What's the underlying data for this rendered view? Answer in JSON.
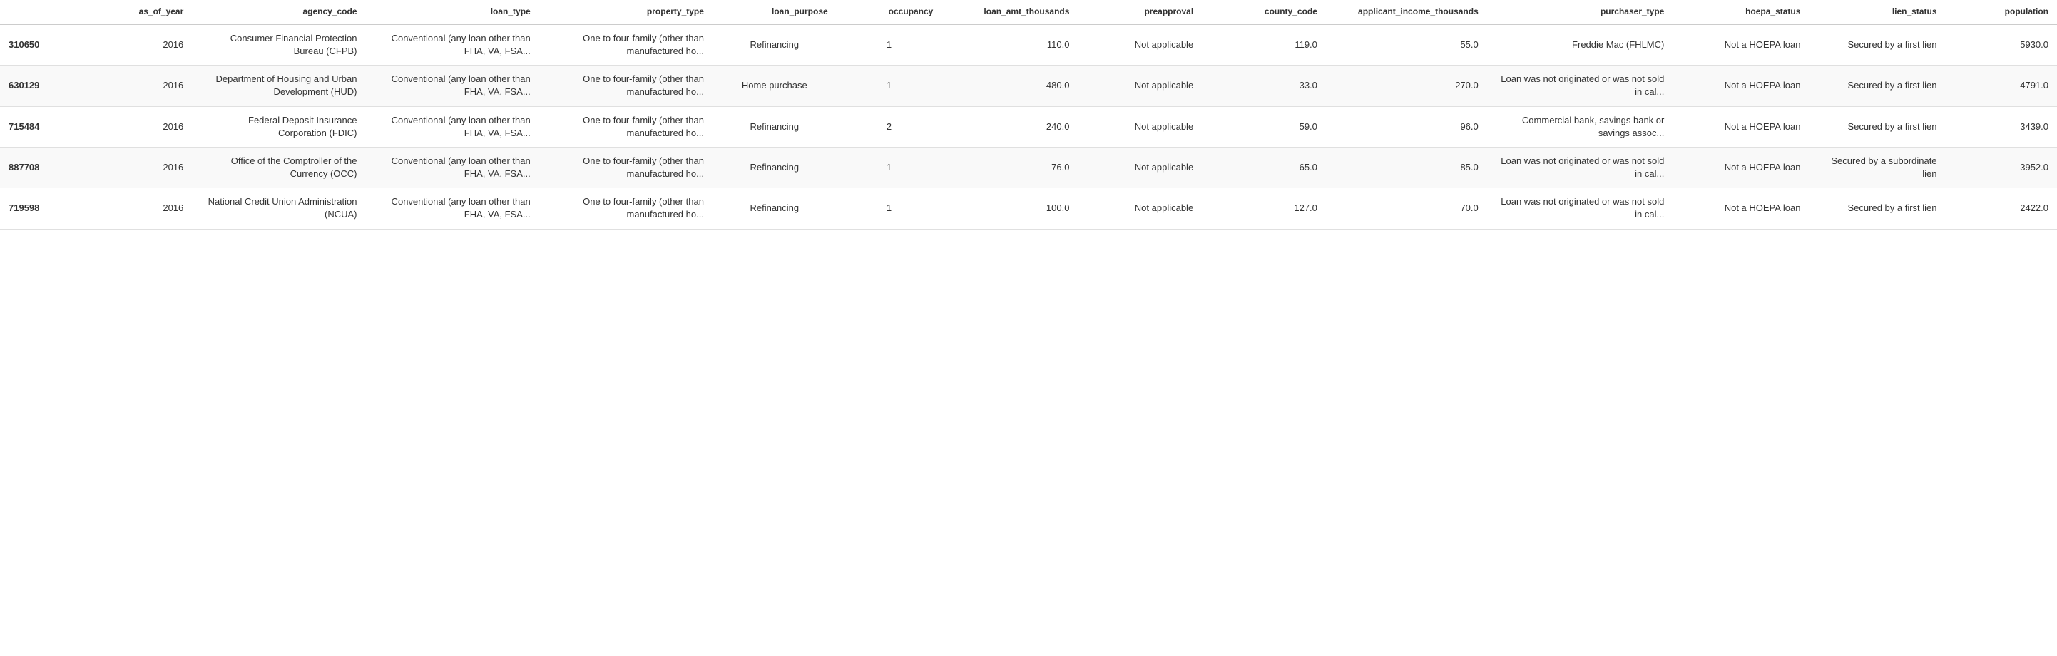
{
  "table": {
    "columns": [
      {
        "id": "id_col",
        "label": "",
        "key": "id"
      },
      {
        "id": "as_of_year",
        "label": "as_of_year",
        "key": "as_of_year"
      },
      {
        "id": "agency_code",
        "label": "agency_code",
        "key": "agency_code"
      },
      {
        "id": "loan_type",
        "label": "loan_type",
        "key": "loan_type"
      },
      {
        "id": "property_type",
        "label": "property_type",
        "key": "property_type"
      },
      {
        "id": "loan_purpose",
        "label": "loan_purpose",
        "key": "loan_purpose"
      },
      {
        "id": "occupancy",
        "label": "occupancy",
        "key": "occupancy"
      },
      {
        "id": "loan_amt_thousands",
        "label": "loan_amt_thousands",
        "key": "loan_amt_thousands"
      },
      {
        "id": "preapproval",
        "label": "preapproval",
        "key": "preapproval"
      },
      {
        "id": "county_code",
        "label": "county_code",
        "key": "county_code"
      },
      {
        "id": "applicant_income_thousands",
        "label": "applicant_income_thousands",
        "key": "applicant_income_thousands"
      },
      {
        "id": "purchaser_type",
        "label": "purchaser_type",
        "key": "purchaser_type"
      },
      {
        "id": "hoepa_status",
        "label": "hoepa_status",
        "key": "hoepa_status"
      },
      {
        "id": "lien_status",
        "label": "lien_status",
        "key": "lien_status"
      },
      {
        "id": "population",
        "label": "population",
        "key": "population"
      }
    ],
    "rows": [
      {
        "id": "310650",
        "as_of_year": "2016",
        "agency_code": "Consumer Financial Protection Bureau (CFPB)",
        "loan_type": "Conventional (any loan other than FHA, VA, FSA...",
        "property_type": "One to four-family (other than manufactured ho...",
        "loan_purpose": "Refinancing",
        "occupancy": "1",
        "loan_amt_thousands": "110.0",
        "preapproval": "Not applicable",
        "county_code": "119.0",
        "applicant_income_thousands": "55.0",
        "purchaser_type": "Freddie Mac (FHLMC)",
        "hoepa_status": "Not a HOEPA loan",
        "lien_status": "Secured by a first lien",
        "population": "5930.0"
      },
      {
        "id": "630129",
        "as_of_year": "2016",
        "agency_code": "Department of Housing and Urban Development (HUD)",
        "loan_type": "Conventional (any loan other than FHA, VA, FSA...",
        "property_type": "One to four-family (other than manufactured ho...",
        "loan_purpose": "Home purchase",
        "occupancy": "1",
        "loan_amt_thousands": "480.0",
        "preapproval": "Not applicable",
        "county_code": "33.0",
        "applicant_income_thousands": "270.0",
        "purchaser_type": "Loan was not originated or was not sold in cal...",
        "hoepa_status": "Not a HOEPA loan",
        "lien_status": "Secured by a first lien",
        "population": "4791.0"
      },
      {
        "id": "715484",
        "as_of_year": "2016",
        "agency_code": "Federal Deposit Insurance Corporation (FDIC)",
        "loan_type": "Conventional (any loan other than FHA, VA, FSA...",
        "property_type": "One to four-family (other than manufactured ho...",
        "loan_purpose": "Refinancing",
        "occupancy": "2",
        "loan_amt_thousands": "240.0",
        "preapproval": "Not applicable",
        "county_code": "59.0",
        "applicant_income_thousands": "96.0",
        "purchaser_type": "Commercial bank, savings bank or savings assoc...",
        "hoepa_status": "Not a HOEPA loan",
        "lien_status": "Secured by a first lien",
        "population": "3439.0"
      },
      {
        "id": "887708",
        "as_of_year": "2016",
        "agency_code": "Office of the Comptroller of the Currency (OCC)",
        "loan_type": "Conventional (any loan other than FHA, VA, FSA...",
        "property_type": "One to four-family (other than manufactured ho...",
        "loan_purpose": "Refinancing",
        "occupancy": "1",
        "loan_amt_thousands": "76.0",
        "preapproval": "Not applicable",
        "county_code": "65.0",
        "applicant_income_thousands": "85.0",
        "purchaser_type": "Loan was not originated or was not sold in cal...",
        "hoepa_status": "Not a HOEPA loan",
        "lien_status": "Secured by a subordinate lien",
        "population": "3952.0"
      },
      {
        "id": "719598",
        "as_of_year": "2016",
        "agency_code": "National Credit Union Administration (NCUA)",
        "loan_type": "Conventional (any loan other than FHA, VA, FSA...",
        "property_type": "One to four-family (other than manufactured ho...",
        "loan_purpose": "Refinancing",
        "occupancy": "1",
        "loan_amt_thousands": "100.0",
        "preapproval": "Not applicable",
        "county_code": "127.0",
        "applicant_income_thousands": "70.0",
        "purchaser_type": "Loan was not originated or was not sold in cal...",
        "hoepa_status": "Not a HOEPA loan",
        "lien_status": "Secured by a first lien",
        "population": "2422.0"
      }
    ]
  }
}
